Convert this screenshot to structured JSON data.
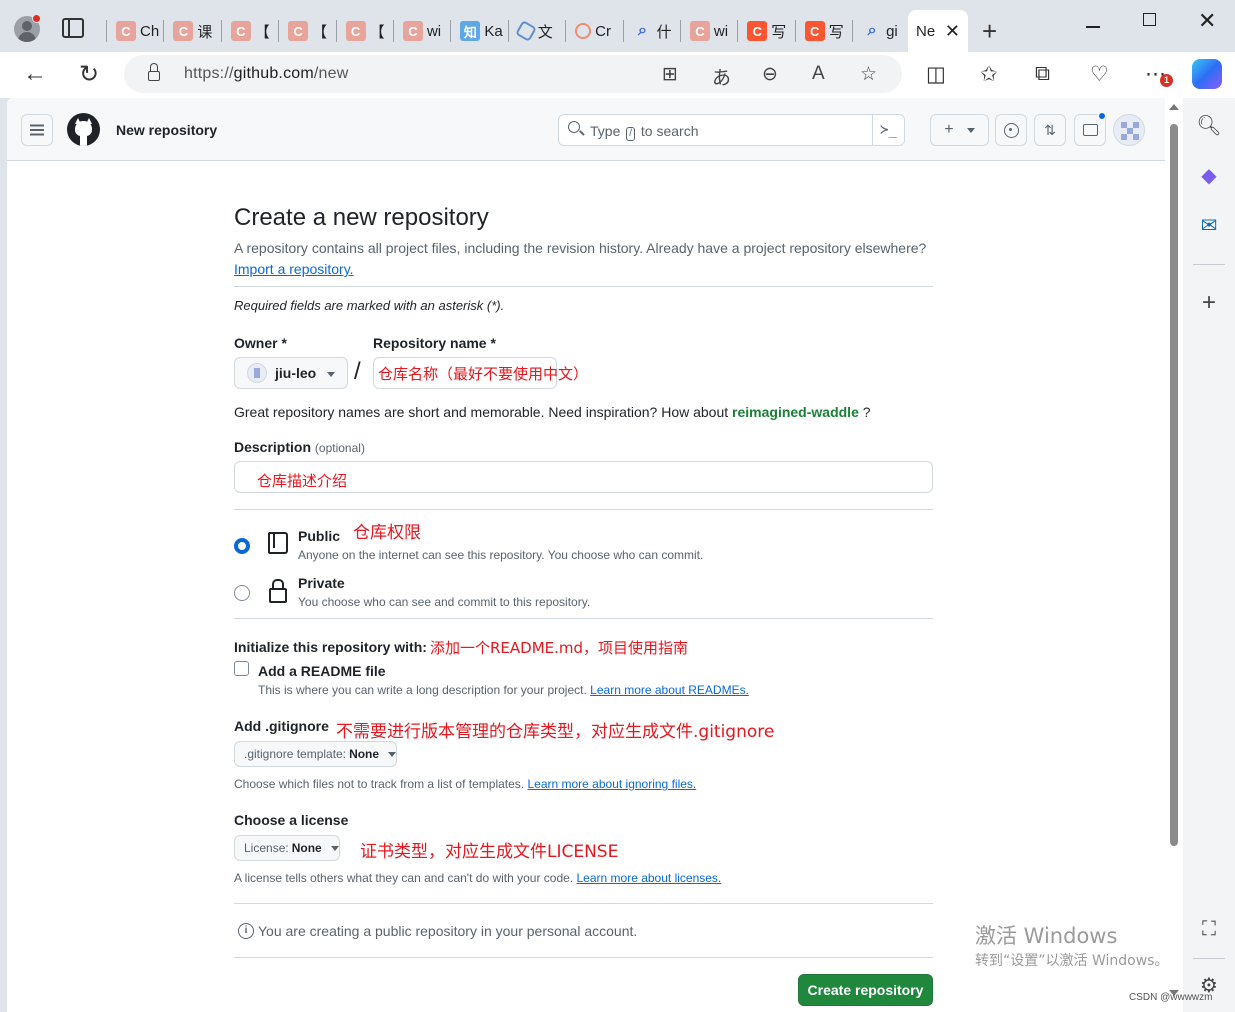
{
  "browser": {
    "tabs": [
      {
        "icon": "c",
        "glyph": "C",
        "title": "Ch"
      },
      {
        "icon": "c",
        "glyph": "C",
        "title": "课"
      },
      {
        "icon": "c",
        "glyph": "C",
        "title": "【"
      },
      {
        "icon": "c",
        "glyph": "C",
        "title": "【"
      },
      {
        "icon": "c",
        "glyph": "C",
        "title": "【"
      },
      {
        "icon": "c",
        "glyph": "C",
        "title": "wi"
      },
      {
        "icon": "zhi",
        "glyph": "知",
        "title": "Ka"
      },
      {
        "icon": "hex",
        "glyph": "",
        "title": "文"
      },
      {
        "icon": "ring",
        "glyph": "",
        "title": "Cr"
      },
      {
        "icon": "srch",
        "glyph": "⌕",
        "title": "什"
      },
      {
        "icon": "c",
        "glyph": "C",
        "title": "wi"
      },
      {
        "icon": "cs",
        "glyph": "C",
        "title": "写"
      },
      {
        "icon": "cs",
        "glyph": "C",
        "title": "写"
      },
      {
        "icon": "srch",
        "glyph": "⌕",
        "title": "gi"
      }
    ],
    "active_tab": {
      "title": "Ne",
      "close": "✕"
    },
    "new_tab": "+",
    "url_scheme": "https://",
    "url_host": "github.com",
    "url_path": "/new",
    "notification_count": "1"
  },
  "github": {
    "page_context": "New repository",
    "search_placeholder_pre": "Type",
    "search_placeholder_key": "/",
    "search_placeholder_post": "to search",
    "command_palette": "≻_"
  },
  "form": {
    "title": "Create a new repository",
    "subtitle": "A repository contains all project files, including the revision history. Already have a project repository elsewhere?",
    "import_link": "Import a repository.",
    "required_note": "Required fields are marked with an asterisk (*).",
    "owner_label": "Owner *",
    "owner_value": "jiu-leo",
    "slash": "/",
    "repo_label": "Repository name *",
    "hint_pre": "Great repository names are short and memorable. Need inspiration? How about",
    "hint_suggestion": "reimagined-waddle",
    "hint_post": "?",
    "description_label": "Description",
    "description_optional": "(optional)",
    "public_title": "Public",
    "public_desc": "Anyone on the internet can see this repository. You choose who can commit.",
    "private_title": "Private",
    "private_desc": "You choose who can see and commit to this repository.",
    "init_label": "Initialize this repository with:",
    "readme_label": "Add a README file",
    "readme_note": "This is where you can write a long description for your project.",
    "readme_link": "Learn more about READMEs.",
    "gitignore_label": "Add .gitignore",
    "gitignore_select_prefix": ".gitignore template:",
    "gitignore_select_value": "None",
    "gitignore_note": "Choose which files not to track from a list of templates.",
    "gitignore_link": "Learn more about ignoring files.",
    "license_label": "Choose a license",
    "license_select_prefix": "License:",
    "license_select_value": "None",
    "license_note": "A license tells others what they can and can't do with your code.",
    "license_link": "Learn more about licenses.",
    "info_text": "You are creating a public repository in your personal account.",
    "create_button": "Create repository",
    "public_selected": true,
    "readme_checked": false
  },
  "annotations": {
    "repo_name": "仓库名称（最好不要使用中文）",
    "description": "仓库描述介绍",
    "visibility": "仓库权限",
    "readme": "添加一个README.md，项目使用指南",
    "gitignore": "不需要进行版本管理的仓库类型，对应生成文件.gitignore",
    "license": "证书类型，对应生成文件LICENSE"
  },
  "overlay": {
    "watermark_line1": "激活 Windows",
    "watermark_line2": "转到“设置”以激活 Windows。",
    "credit": "CSDN @wwwwzm"
  },
  "colors": {
    "primary_button": "#1f883d",
    "link": "#0969da",
    "suggestion": "#1a7f37",
    "annotation": "#e8161e"
  }
}
